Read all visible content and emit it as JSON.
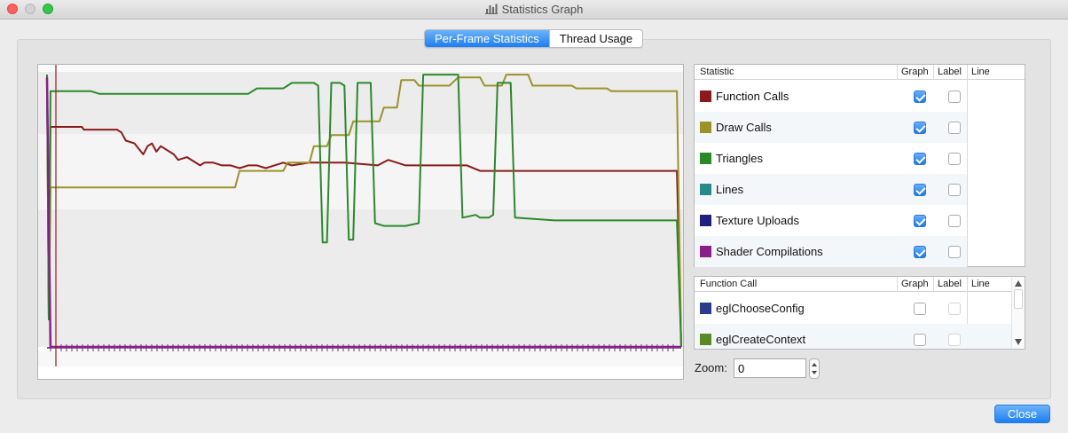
{
  "window": {
    "title": "Statistics Graph",
    "icon": "bar-chart-icon"
  },
  "tabs": [
    {
      "label": "Per-Frame Statistics",
      "active": true
    },
    {
      "label": "Thread Usage",
      "active": false
    }
  ],
  "statistics_table": {
    "columns": [
      "Statistic",
      "Graph",
      "Label",
      "Line"
    ],
    "rows": [
      {
        "name": "Function Calls",
        "color": "#8b1a1a",
        "graph": true,
        "label": false
      },
      {
        "name": "Draw Calls",
        "color": "#9a9428",
        "graph": true,
        "label": false
      },
      {
        "name": "Triangles",
        "color": "#2a8a2a",
        "graph": true,
        "label": false
      },
      {
        "name": "Lines",
        "color": "#268a8a",
        "graph": true,
        "label": false
      },
      {
        "name": "Texture Uploads",
        "color": "#1f1f80",
        "graph": true,
        "label": false
      },
      {
        "name": "Shader Compilations",
        "color": "#8a1f8a",
        "graph": true,
        "label": false
      }
    ]
  },
  "function_call_table": {
    "columns": [
      "Function Call",
      "Graph",
      "Label",
      "Line"
    ],
    "rows": [
      {
        "name": "eglChooseConfig",
        "color": "#2b3c8c",
        "graph": false,
        "label": false
      },
      {
        "name": "eglCreateContext",
        "color": "#5a8a26",
        "graph": false,
        "label": false
      }
    ]
  },
  "zoom": {
    "label": "Zoom:",
    "value": "0"
  },
  "buttons": {
    "close": "Close"
  },
  "chart_data": {
    "type": "line",
    "x_frame_count": 118,
    "grid": true,
    "series": [
      {
        "name": "Function Calls",
        "color": "#8b1a1a",
        "points": [
          [
            0,
            99
          ],
          [
            2,
            10
          ],
          [
            4,
            80
          ],
          [
            40,
            80
          ],
          [
            42,
            79
          ],
          [
            80,
            79
          ],
          [
            85,
            78
          ],
          [
            90,
            75
          ],
          [
            100,
            74
          ],
          [
            110,
            70
          ],
          [
            115,
            73
          ],
          [
            120,
            74
          ],
          [
            125,
            71
          ],
          [
            130,
            73
          ],
          [
            145,
            70
          ],
          [
            150,
            68
          ],
          [
            160,
            69
          ],
          [
            175,
            66
          ],
          [
            180,
            67
          ],
          [
            190,
            67
          ],
          [
            200,
            66
          ],
          [
            210,
            66
          ],
          [
            220,
            65
          ],
          [
            230,
            66
          ],
          [
            240,
            66
          ],
          [
            250,
            65
          ],
          [
            260,
            66
          ],
          [
            270,
            67
          ],
          [
            280,
            66
          ],
          [
            300,
            67
          ],
          [
            340,
            67
          ],
          [
            378,
            66
          ],
          [
            390,
            68
          ],
          [
            410,
            66
          ],
          [
            480,
            66
          ],
          [
            495,
            64
          ],
          [
            720,
            64
          ],
          [
            725,
            0
          ]
        ]
      },
      {
        "name": "Draw Calls",
        "color": "#9a9428",
        "points": [
          [
            0,
            99
          ],
          [
            2,
            10
          ],
          [
            4,
            58
          ],
          [
            90,
            58
          ],
          [
            110,
            58
          ],
          [
            215,
            58
          ],
          [
            220,
            64
          ],
          [
            270,
            64
          ],
          [
            275,
            67
          ],
          [
            300,
            67
          ],
          [
            305,
            73
          ],
          [
            320,
            73
          ],
          [
            325,
            77
          ],
          [
            345,
            77
          ],
          [
            350,
            82
          ],
          [
            380,
            82
          ],
          [
            385,
            87
          ],
          [
            400,
            87
          ],
          [
            405,
            97
          ],
          [
            420,
            97
          ],
          [
            425,
            95
          ],
          [
            460,
            95
          ],
          [
            470,
            98
          ],
          [
            495,
            98
          ],
          [
            500,
            95
          ],
          [
            520,
            95
          ],
          [
            525,
            99
          ],
          [
            550,
            99
          ],
          [
            555,
            95
          ],
          [
            600,
            95
          ],
          [
            605,
            94
          ],
          [
            640,
            94
          ],
          [
            645,
            93
          ],
          [
            680,
            93
          ],
          [
            720,
            93
          ],
          [
            725,
            0
          ]
        ]
      },
      {
        "name": "Triangles",
        "color": "#2a8a2a",
        "points": [
          [
            0,
            99
          ],
          [
            2,
            10
          ],
          [
            4,
            93
          ],
          [
            50,
            93
          ],
          [
            60,
            92
          ],
          [
            230,
            92
          ],
          [
            240,
            94
          ],
          [
            270,
            94
          ],
          [
            280,
            96
          ],
          [
            305,
            96
          ],
          [
            310,
            95
          ],
          [
            315,
            38
          ],
          [
            320,
            38
          ],
          [
            325,
            96
          ],
          [
            335,
            96
          ],
          [
            340,
            95
          ],
          [
            345,
            39
          ],
          [
            350,
            39
          ],
          [
            355,
            96
          ],
          [
            365,
            96
          ],
          [
            370,
            96
          ],
          [
            375,
            45
          ],
          [
            385,
            44
          ],
          [
            400,
            44
          ],
          [
            410,
            44
          ],
          [
            425,
            45
          ],
          [
            430,
            99
          ],
          [
            470,
            99
          ],
          [
            475,
            47
          ],
          [
            490,
            48
          ],
          [
            495,
            47
          ],
          [
            505,
            47
          ],
          [
            510,
            48
          ],
          [
            515,
            96
          ],
          [
            530,
            96
          ],
          [
            535,
            47
          ],
          [
            580,
            46
          ],
          [
            620,
            46
          ],
          [
            720,
            46
          ],
          [
            725,
            0
          ]
        ]
      },
      {
        "name": "Shader Compilations",
        "color": "#8a1f8a",
        "points": [
          [
            0,
            98
          ],
          [
            4,
            0
          ],
          [
            725,
            0
          ]
        ]
      }
    ]
  }
}
